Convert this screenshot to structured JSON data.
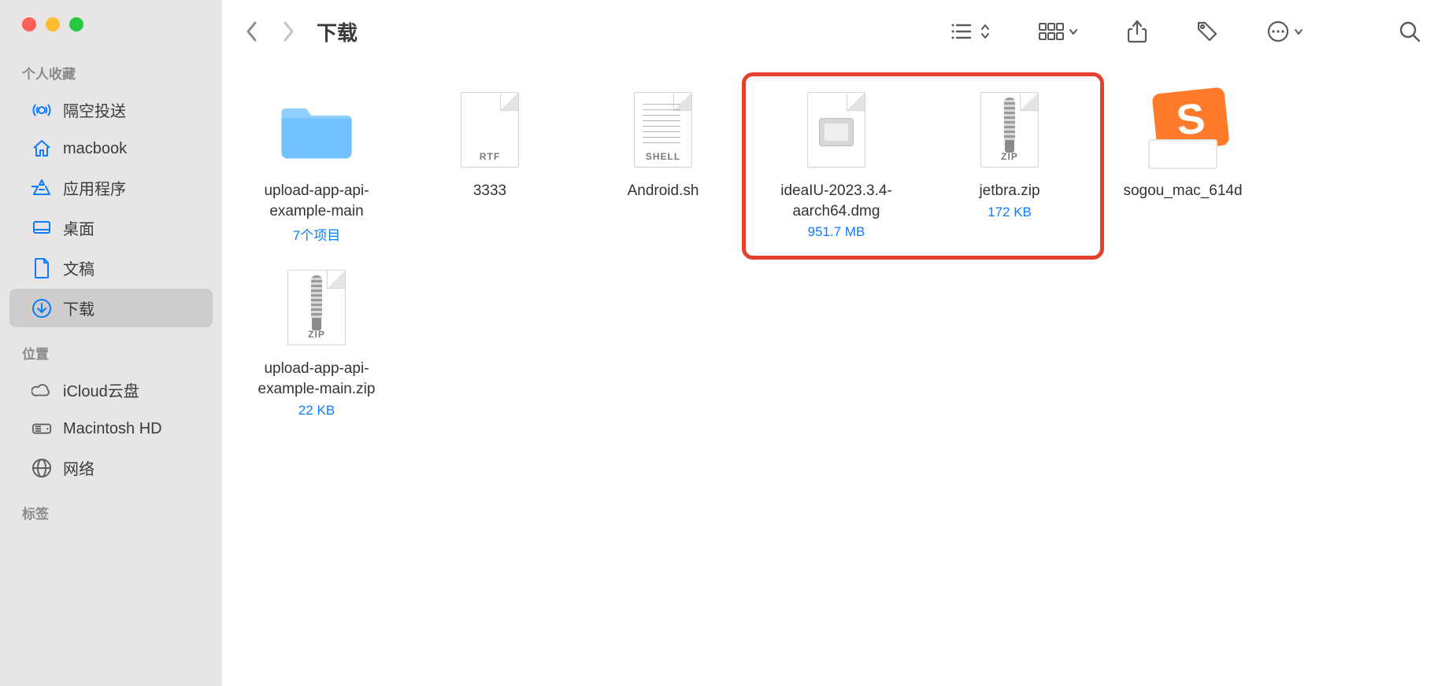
{
  "window": {
    "title": "下载"
  },
  "sidebar": {
    "sections": [
      {
        "header": "个人收藏",
        "items": [
          {
            "icon": "airdrop",
            "label": "隔空投送"
          },
          {
            "icon": "house",
            "label": "macbook"
          },
          {
            "icon": "apps",
            "label": "应用程序"
          },
          {
            "icon": "desktop",
            "label": "桌面"
          },
          {
            "icon": "doc",
            "label": "文稿"
          },
          {
            "icon": "download",
            "label": "下载",
            "selected": true
          }
        ]
      },
      {
        "header": "位置",
        "items": [
          {
            "icon": "cloud",
            "gray": true,
            "label": "iCloud云盘"
          },
          {
            "icon": "hdd",
            "gray": true,
            "label": "Macintosh HD"
          },
          {
            "icon": "globe",
            "gray": true,
            "label": "网络"
          }
        ]
      },
      {
        "header": "标签",
        "items": []
      }
    ]
  },
  "toolbar": {
    "view_list_label": "列表视图",
    "view_group_label": "分组",
    "share_label": "共享",
    "tag_label": "标签",
    "more_label": "更多",
    "search_label": "搜索"
  },
  "files": [
    {
      "kind": "folder",
      "name": "upload-app-api-example-main",
      "sub": "7个项目"
    },
    {
      "kind": "rtf",
      "name": "3333",
      "badge": "RTF"
    },
    {
      "kind": "shell",
      "name": "Android.sh",
      "badge": "SHELL"
    },
    {
      "kind": "dmg",
      "name": "ideaIU-2023.3.4-aarch64.dmg",
      "sub": "951.7 MB",
      "highlighted": true
    },
    {
      "kind": "zip",
      "name": "jetbra.zip",
      "sub": "172 KB",
      "badge": "ZIP",
      "highlighted": true
    },
    {
      "kind": "sogou",
      "name": "sogou_mac_614d"
    },
    {
      "kind": "zip",
      "name": "upload-app-api-example-main.zip",
      "sub": "22 KB",
      "badge": "ZIP"
    }
  ],
  "highlight_color": "#e4402b"
}
